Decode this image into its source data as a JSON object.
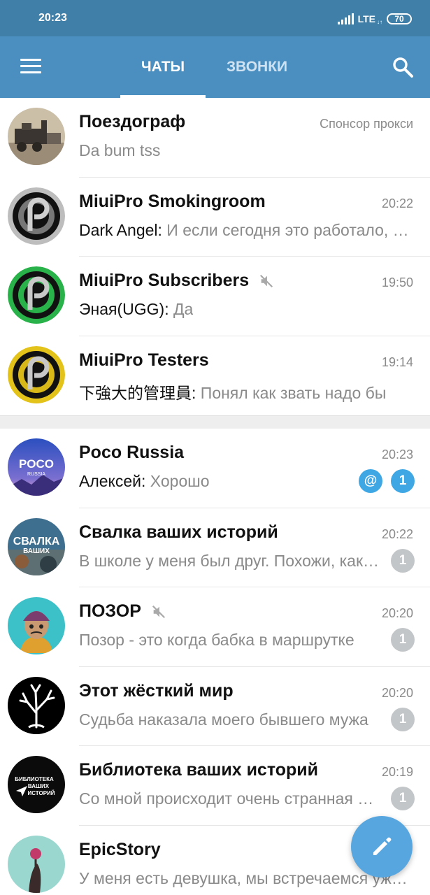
{
  "status_bar": {
    "time": "20:23",
    "network": "LTE",
    "battery": "70"
  },
  "app_bar": {
    "tabs": [
      "ЧАТЫ",
      "ЗВОНКИ"
    ],
    "active_tab": "ЧАТЫ"
  },
  "pinned_chats": [
    {
      "name": "Поездограф",
      "time": "Спонсор прокси",
      "sender": "",
      "text": "Da bum tss",
      "muted": false
    },
    {
      "name": "MiuiPro Smokingroom",
      "time": "20:22",
      "sender": "Dark Angel: ",
      "text": "И если сегодня это работало, а завтра нет",
      "muted": false
    },
    {
      "name": "MiuiPro Subscribers",
      "time": "19:50",
      "sender": "Эная(UGG): ",
      "text": "Да",
      "muted": true
    },
    {
      "name": "MiuiPro Testers",
      "time": "19:14",
      "sender": "下強大的管理員: ",
      "text": "Понял как звать надо бы",
      "muted": false
    }
  ],
  "chats": [
    {
      "name": "Poco Russia",
      "time": "20:23",
      "sender": "Алексей: ",
      "text": "Хорошо",
      "muted": false,
      "mention": "@",
      "unread": "1"
    },
    {
      "name": "Свалка ваших историй",
      "time": "20:22",
      "sender": "",
      "text": "В школе у меня был друг. Похожи, как братья",
      "muted": false,
      "unread": "1"
    },
    {
      "name": "ПОЗОР",
      "time": "20:20",
      "sender": "",
      "text": "Позор - это когда бабка в маршрутке",
      "muted": true,
      "unread": "1"
    },
    {
      "name": "Этот жёсткий мир",
      "time": "20:20",
      "sender": "",
      "text": "Судьба наказала моего бывшего мужа",
      "muted": false,
      "unread": "1"
    },
    {
      "name": "Библиотека ваших историй",
      "time": "20:19",
      "sender": "",
      "text": "Со мной происходит очень странная вещь",
      "muted": false,
      "unread": "1"
    },
    {
      "name": "EpicStory",
      "time": "",
      "sender": "",
      "text": "У меня есть девушка, мы встречаемся уже год",
      "muted": false,
      "unread": ""
    }
  ],
  "avatar_texts": {
    "poco": "POCO",
    "poco_sub": "RUSSIA",
    "svalka": "СВАЛКА",
    "svalka_sub": "ВАШИХ",
    "biblio": "БИБЛИОТЕКА",
    "biblio_sub1": "ВАШИХ",
    "biblio_sub2": "ИСТОРИЙ"
  },
  "colors": {
    "status_bar": "#3f7fa8",
    "app_bar": "#4a8fc0",
    "accent": "#3fa7e4",
    "badge_muted": "#c3c6c9",
    "fab": "#57a6e0"
  },
  "icons": {
    "menu": "menu-icon",
    "search": "search-icon",
    "mute": "mute-icon",
    "compose": "pencil-icon"
  }
}
